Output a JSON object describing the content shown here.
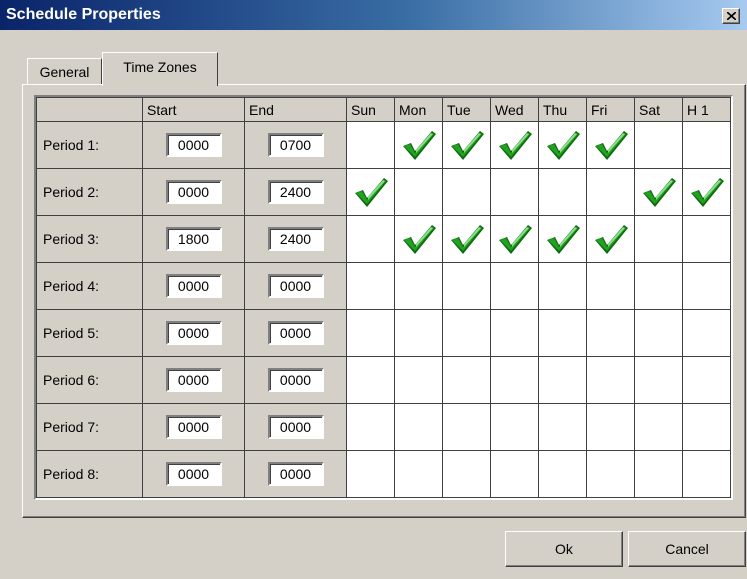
{
  "window": {
    "title": "Schedule Properties"
  },
  "tabs": [
    {
      "label": "General",
      "active": false
    },
    {
      "label": "Time Zones",
      "active": true
    }
  ],
  "grid": {
    "columns": [
      "",
      "Start",
      "End",
      "Sun",
      "Mon",
      "Tue",
      "Wed",
      "Thu",
      "Fri",
      "Sat",
      "H 1"
    ],
    "rows": [
      {
        "label": "Period 1:",
        "start": "0000",
        "end": "0700",
        "days": [
          false,
          true,
          true,
          true,
          true,
          true,
          false,
          false
        ]
      },
      {
        "label": "Period 2:",
        "start": "0000",
        "end": "2400",
        "days": [
          true,
          false,
          false,
          false,
          false,
          false,
          true,
          true
        ]
      },
      {
        "label": "Period 3:",
        "start": "1800",
        "end": "2400",
        "days": [
          false,
          true,
          true,
          true,
          true,
          true,
          false,
          false
        ]
      },
      {
        "label": "Period 4:",
        "start": "0000",
        "end": "0000",
        "days": [
          false,
          false,
          false,
          false,
          false,
          false,
          false,
          false
        ]
      },
      {
        "label": "Period 5:",
        "start": "0000",
        "end": "0000",
        "days": [
          false,
          false,
          false,
          false,
          false,
          false,
          false,
          false
        ]
      },
      {
        "label": "Period 6:",
        "start": "0000",
        "end": "0000",
        "days": [
          false,
          false,
          false,
          false,
          false,
          false,
          false,
          false
        ]
      },
      {
        "label": "Period 7:",
        "start": "0000",
        "end": "0000",
        "days": [
          false,
          false,
          false,
          false,
          false,
          false,
          false,
          false
        ]
      },
      {
        "label": "Period 8:",
        "start": "0000",
        "end": "0000",
        "days": [
          false,
          false,
          false,
          false,
          false,
          false,
          false,
          false
        ]
      }
    ],
    "check_icon": "checkmark-icon",
    "check_color": "#22a022"
  },
  "buttons": {
    "ok": "Ok",
    "cancel": "Cancel"
  },
  "colors": {
    "title_start": "#0a246a",
    "title_end": "#a6caf0",
    "face": "#d4d0c8"
  }
}
